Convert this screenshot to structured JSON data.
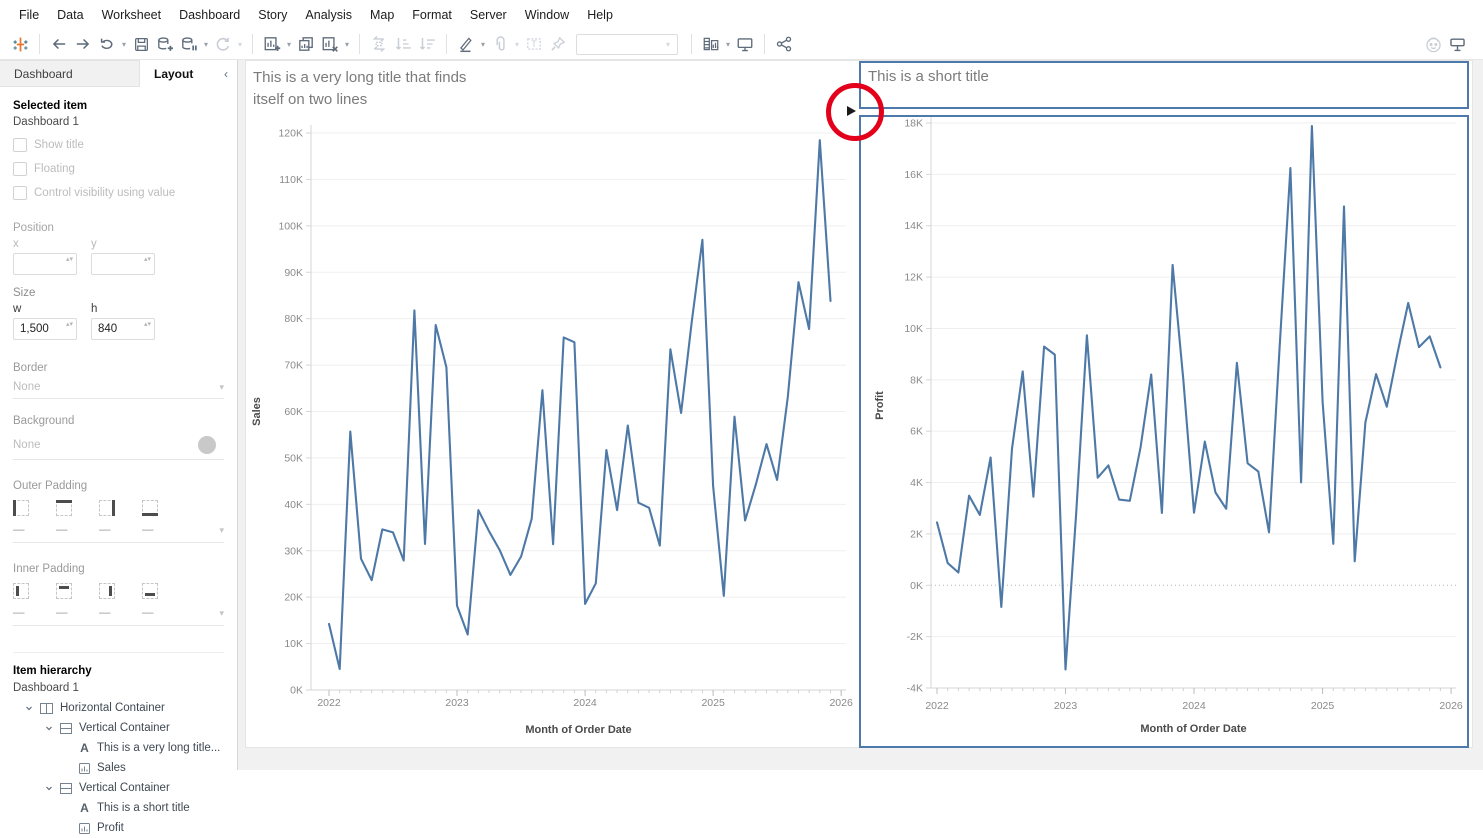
{
  "menu": {
    "items": [
      "File",
      "Data",
      "Worksheet",
      "Dashboard",
      "Story",
      "Analysis",
      "Map",
      "Format",
      "Server",
      "Window",
      "Help"
    ]
  },
  "toolbar": {
    "icons": [
      "tableau-logo",
      "back",
      "forward",
      "replay-animation",
      "save",
      "new-data-source",
      "pause-auto-updates",
      "run-auto-updates",
      "new-worksheet",
      "duplicate-sheet",
      "clear-sheet",
      "swap-rows-columns",
      "sort-ascending",
      "sort-descending",
      "highlight",
      "group-members",
      "show-mark-labels",
      "fix-axes",
      "fit-selector",
      "show-hide-cards",
      "presentation-mode",
      "share-workbook",
      "einstein-copilot",
      "show-me"
    ],
    "fit_selector_value": ""
  },
  "left_panel": {
    "tabs": [
      {
        "label": "Dashboard"
      },
      {
        "label": "Layout"
      }
    ],
    "collapse_glyph": "‹",
    "selected_item": {
      "heading": "Selected item",
      "name": "Dashboard 1"
    },
    "checkboxes": [
      {
        "label": "Show title"
      },
      {
        "label": "Floating"
      },
      {
        "label": "Control visibility using value"
      }
    ],
    "position": {
      "heading": "Position",
      "x_label": "x",
      "y_label": "y",
      "x_value": "",
      "y_value": ""
    },
    "size": {
      "heading": "Size",
      "w_label": "w",
      "h_label": "h",
      "w_value": "1,500",
      "h_value": "840"
    },
    "border": {
      "heading": "Border",
      "value": "None"
    },
    "background": {
      "heading": "Background",
      "value": "None"
    },
    "outer_padding": {
      "heading": "Outer Padding",
      "values": [
        "—",
        "—",
        "—",
        "—"
      ]
    },
    "inner_padding": {
      "heading": "Inner Padding",
      "values": [
        "—",
        "—",
        "—",
        "—"
      ]
    },
    "hierarchy": {
      "heading": "Item hierarchy",
      "root": "Dashboard 1",
      "items": [
        {
          "label": "Horizontal Container"
        },
        {
          "label": "Vertical Container"
        },
        {
          "label": "This is a very long title..."
        },
        {
          "label": "Sales"
        },
        {
          "label": "Vertical Container"
        },
        {
          "label": "This is a short title"
        },
        {
          "label": "Profit"
        }
      ]
    }
  },
  "annotation": {
    "highlight_circle_color": "#e3001b",
    "highlights": "container selection handle arrow"
  },
  "chart_data": [
    {
      "type": "line",
      "title": "This is a very long title that finds itself on two lines",
      "xlabel": "Month of Order Date",
      "ylabel": "Sales",
      "line_color": "#4e79a7",
      "ylim": [
        0,
        120000
      ],
      "x_ticks": [
        {
          "m": 0,
          "label": "2022"
        },
        {
          "m": 12,
          "label": "2023"
        },
        {
          "m": 24,
          "label": "2024"
        },
        {
          "m": 36,
          "label": "2025"
        },
        {
          "m": 48,
          "label": "2026"
        }
      ],
      "y_ticks": [
        {
          "v": 0,
          "label": "0K"
        },
        {
          "v": 10000,
          "label": "10K"
        },
        {
          "v": 20000,
          "label": "20K"
        },
        {
          "v": 30000,
          "label": "30K"
        },
        {
          "v": 40000,
          "label": "40K"
        },
        {
          "v": 50000,
          "label": "50K"
        },
        {
          "v": 60000,
          "label": "60K"
        },
        {
          "v": 70000,
          "label": "70K"
        },
        {
          "v": 80000,
          "label": "80K"
        },
        {
          "v": 90000,
          "label": "90K"
        },
        {
          "v": 100000,
          "label": "100K"
        },
        {
          "v": 110000,
          "label": "110K"
        },
        {
          "v": 120000,
          "label": "120K"
        }
      ],
      "zero_line_dotted": false,
      "months_start": "2022-01",
      "values": [
        14236,
        4520,
        55691,
        28295,
        23648,
        34595,
        33946,
        27909,
        81777,
        31453,
        78629,
        69546,
        18174,
        11951,
        38726,
        34195,
        30131,
        24797,
        28765,
        36898,
        64595,
        31404,
        75973,
        74920,
        18542,
        22978,
        51715,
        38750,
        56987,
        40344,
        39262,
        31115,
        73410,
        59687,
        79412,
        96999,
        43971,
        20301,
        58872,
        36522,
        44261,
        52981,
        45264,
        63121,
        87867,
        77777,
        118448,
        83829
      ]
    },
    {
      "type": "line",
      "title": "This is a short title",
      "xlabel": "Month of Order Date",
      "ylabel": "Profit",
      "line_color": "#4e79a7",
      "ylim": [
        -4000,
        18000
      ],
      "x_ticks": [
        {
          "m": 0,
          "label": "2022"
        },
        {
          "m": 12,
          "label": "2023"
        },
        {
          "m": 24,
          "label": "2024"
        },
        {
          "m": 36,
          "label": "2025"
        },
        {
          "m": 48,
          "label": "2026"
        }
      ],
      "y_ticks": [
        {
          "v": -4000,
          "label": "-4K"
        },
        {
          "v": -2000,
          "label": "-2K"
        },
        {
          "v": 0,
          "label": "0K"
        },
        {
          "v": 2000,
          "label": "2K"
        },
        {
          "v": 4000,
          "label": "4K"
        },
        {
          "v": 6000,
          "label": "6K"
        },
        {
          "v": 8000,
          "label": "8K"
        },
        {
          "v": 10000,
          "label": "10K"
        },
        {
          "v": 12000,
          "label": "12K"
        },
        {
          "v": 14000,
          "label": "14K"
        },
        {
          "v": 16000,
          "label": "16K"
        },
        {
          "v": 18000,
          "label": "18K"
        }
      ],
      "zero_line_dotted": true,
      "months_start": "2022-01",
      "values": [
        2450,
        862,
        498,
        3489,
        2739,
        4976,
        -841,
        5318,
        8328,
        3448,
        9292,
        8983,
        -3281,
        2813,
        9732,
        4187,
        4667,
        3335,
        3288,
        5355,
        8209,
        2817,
        12474,
        8016,
        2825,
        5593,
        3611,
        2977,
        8662,
        4750,
        4432,
        2062,
        9323,
        16243,
        4011,
        17885,
        7141,
        1614,
        14752,
        934,
        6342,
        8223,
        6953,
        9040,
        10991,
        9275,
        9690,
        8483
      ]
    }
  ]
}
